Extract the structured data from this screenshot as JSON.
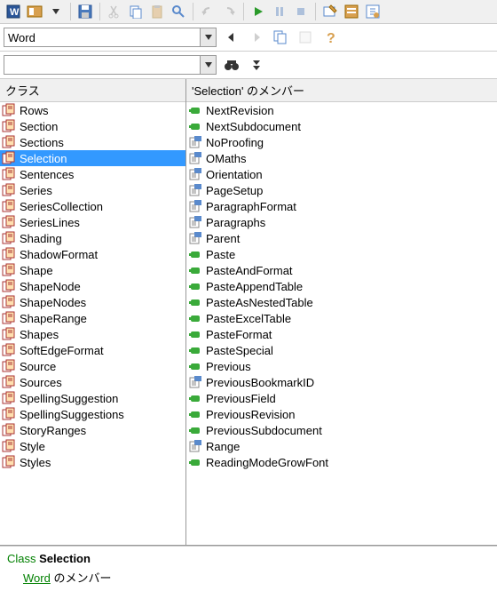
{
  "toolbar": {
    "main_combo_value": "Word",
    "search_input_value": ""
  },
  "panels": {
    "classes_header": "クラス",
    "members_header": "'Selection' のメンバー"
  },
  "classes": [
    {
      "name": "Rows",
      "type": "class"
    },
    {
      "name": "Section",
      "type": "class"
    },
    {
      "name": "Sections",
      "type": "class"
    },
    {
      "name": "Selection",
      "type": "class",
      "selected": true
    },
    {
      "name": "Sentences",
      "type": "class"
    },
    {
      "name": "Series",
      "type": "class"
    },
    {
      "name": "SeriesCollection",
      "type": "class"
    },
    {
      "name": "SeriesLines",
      "type": "class"
    },
    {
      "name": "Shading",
      "type": "class"
    },
    {
      "name": "ShadowFormat",
      "type": "class"
    },
    {
      "name": "Shape",
      "type": "class"
    },
    {
      "name": "ShapeNode",
      "type": "class"
    },
    {
      "name": "ShapeNodes",
      "type": "class"
    },
    {
      "name": "ShapeRange",
      "type": "class"
    },
    {
      "name": "Shapes",
      "type": "class"
    },
    {
      "name": "SoftEdgeFormat",
      "type": "class"
    },
    {
      "name": "Source",
      "type": "class"
    },
    {
      "name": "Sources",
      "type": "class"
    },
    {
      "name": "SpellingSuggestion",
      "type": "class"
    },
    {
      "name": "SpellingSuggestions",
      "type": "class"
    },
    {
      "name": "StoryRanges",
      "type": "class"
    },
    {
      "name": "Style",
      "type": "class"
    },
    {
      "name": "Styles",
      "type": "class"
    }
  ],
  "members": [
    {
      "name": "NextRevision",
      "type": "method"
    },
    {
      "name": "NextSubdocument",
      "type": "method"
    },
    {
      "name": "NoProofing",
      "type": "property"
    },
    {
      "name": "OMaths",
      "type": "property"
    },
    {
      "name": "Orientation",
      "type": "property"
    },
    {
      "name": "PageSetup",
      "type": "property"
    },
    {
      "name": "ParagraphFormat",
      "type": "property"
    },
    {
      "name": "Paragraphs",
      "type": "property"
    },
    {
      "name": "Parent",
      "type": "property"
    },
    {
      "name": "Paste",
      "type": "method"
    },
    {
      "name": "PasteAndFormat",
      "type": "method"
    },
    {
      "name": "PasteAppendTable",
      "type": "method"
    },
    {
      "name": "PasteAsNestedTable",
      "type": "method"
    },
    {
      "name": "PasteExcelTable",
      "type": "method"
    },
    {
      "name": "PasteFormat",
      "type": "method"
    },
    {
      "name": "PasteSpecial",
      "type": "method"
    },
    {
      "name": "Previous",
      "type": "method"
    },
    {
      "name": "PreviousBookmarkID",
      "type": "property"
    },
    {
      "name": "PreviousField",
      "type": "method"
    },
    {
      "name": "PreviousRevision",
      "type": "method"
    },
    {
      "name": "PreviousSubdocument",
      "type": "method"
    },
    {
      "name": "Range",
      "type": "property"
    },
    {
      "name": "ReadingModeGrowFont",
      "type": "method"
    }
  ],
  "status": {
    "class_label": "Class",
    "class_name": "Selection",
    "link_text": "Word",
    "suffix": " のメンバー"
  }
}
